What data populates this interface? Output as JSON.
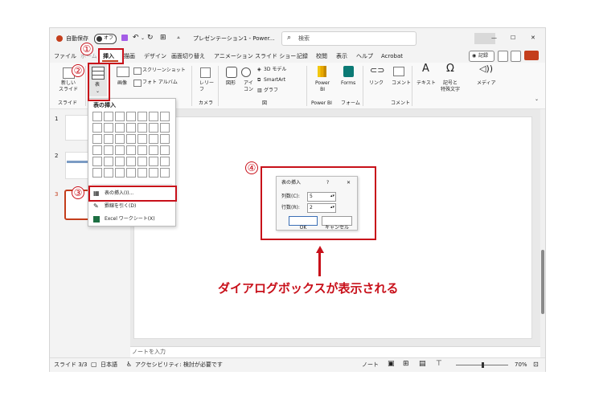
{
  "titlebar": {
    "autosave_label": "自動保存",
    "autosave_state": "オフ",
    "doc_title": "プレゼンテーション1 - Power...",
    "search_placeholder": "検索",
    "window_controls": [
      "—",
      "☐",
      "✕"
    ]
  },
  "menu": {
    "tabs": [
      "ファイル",
      "ホーム",
      "挿入",
      "描画",
      "デザイン",
      "画面切り替え",
      "アニメーション",
      "スライド ショー",
      "記録",
      "校閲",
      "表示",
      "ヘルプ",
      "Acrobat"
    ],
    "active": "挿入",
    "record_button": "記録"
  },
  "ribbon": {
    "new_slide": "新しい\nスライド",
    "group_slide": "スライド",
    "table": "表",
    "image": "画像",
    "screenshot": "スクリーンショット",
    "photo_album": "フォト アルバム",
    "cameo": "レリー\nフ",
    "group_camera": "カメラ",
    "shapes": "図形",
    "icons": "アイ\nコン",
    "model3d": "3D モデル",
    "smartart": "SmartArt",
    "chart": "グラフ",
    "group_figure": "図",
    "powerbi": "Power\nBI",
    "forms": "Forms",
    "group_powerbi": "Power BI",
    "group_form": "フォーム",
    "link": "リンク",
    "comment": "コメント",
    "group_comment": "コメント",
    "text": "テキスト",
    "symbol": "記号と\n特殊文字",
    "media": "メディア"
  },
  "dropdown": {
    "title": "表の挿入",
    "items": [
      "表の挿入(I)...",
      "罫線を引く(D)",
      "Excel ワークシート(X)"
    ]
  },
  "thumbnails": [
    "1",
    "2",
    "3"
  ],
  "dialog": {
    "title": "表の挿入",
    "help": "?",
    "close": "✕",
    "cols_label": "列数(C):",
    "cols_value": "5",
    "rows_label": "行数(R):",
    "rows_value": "2",
    "ok": "OK",
    "cancel": "キャンセル"
  },
  "annotations": {
    "step1": "①",
    "step2": "②",
    "step3": "③",
    "step4": "④",
    "caption": "ダイアログボックスが表示される",
    "accent_color": "#c8101a"
  },
  "notes_placeholder": "ノートを入力",
  "status": {
    "slide": "スライド 3/3",
    "language": "日本語",
    "accessibility": "アクセシビリティ: 検討が必要です",
    "notes": "ノート",
    "zoom": "70%"
  }
}
